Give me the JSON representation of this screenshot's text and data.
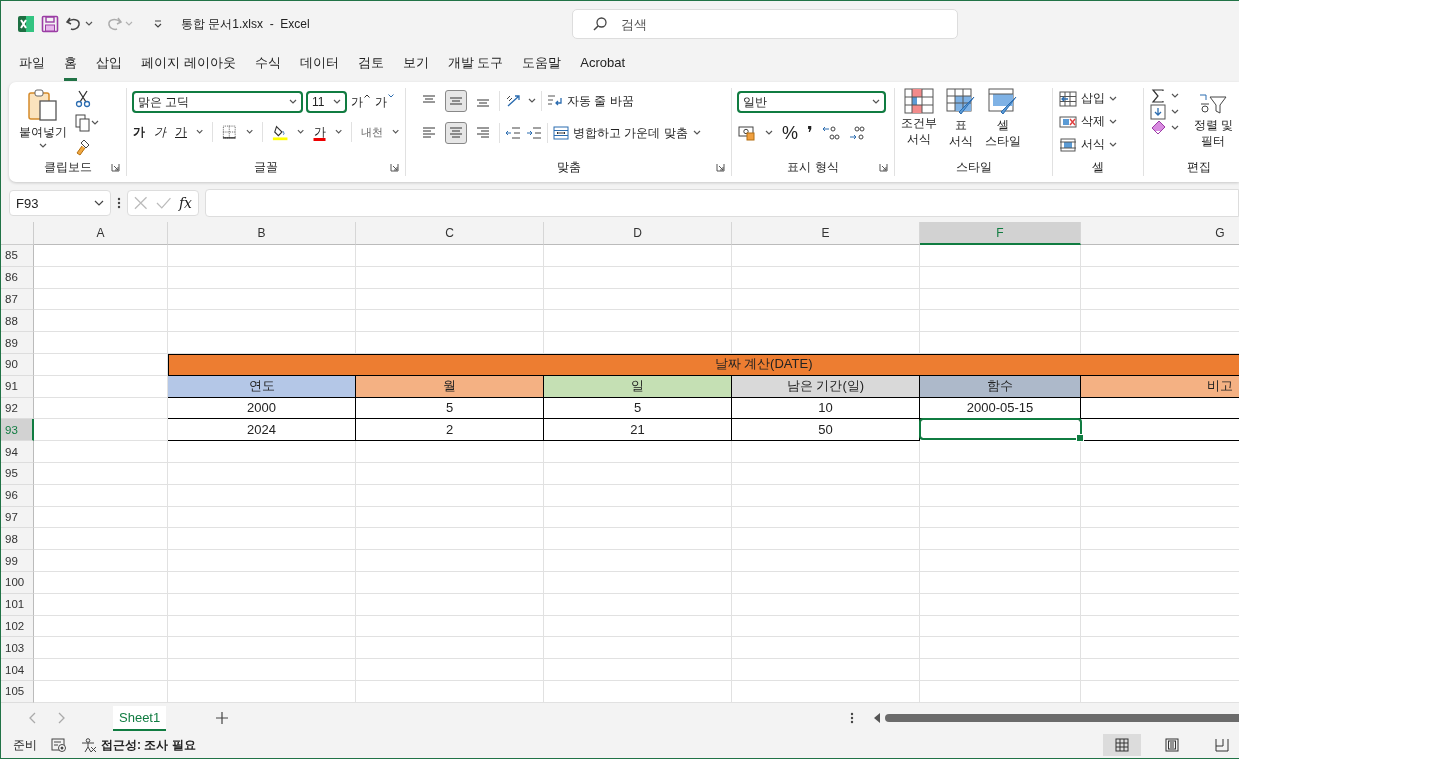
{
  "title_bar": {
    "title": "통합 문서1.xlsx  -  Excel",
    "search": {
      "placeholder": "검색"
    },
    "redo_disabled": true
  },
  "menu_tabs": [
    {
      "label": "파일",
      "selected": false
    },
    {
      "label": "홈",
      "selected": true
    },
    {
      "label": "삽입",
      "selected": false
    },
    {
      "label": "페이지 레이아웃",
      "selected": false
    },
    {
      "label": "수식",
      "selected": false
    },
    {
      "label": "데이터",
      "selected": false
    },
    {
      "label": "검토",
      "selected": false
    },
    {
      "label": "보기",
      "selected": false
    },
    {
      "label": "개발 도구",
      "selected": false
    },
    {
      "label": "도움말",
      "selected": false
    },
    {
      "label": "Acrobat",
      "selected": false
    }
  ],
  "ribbon": {
    "clipboard": {
      "label": "클립보드",
      "paste": "붙여넣기"
    },
    "font": {
      "label": "글꼴",
      "font_name": "맑은 고딕",
      "font_size": "11",
      "grow": "가",
      "shrink": "가",
      "bold": "가",
      "italic": "가",
      "underline": "가",
      "font_color": "가",
      "phonetic": "내천"
    },
    "alignment": {
      "label": "맞춤",
      "vertical": [
        {
          "selected": false
        },
        {
          "selected": true
        },
        {
          "selected": false
        }
      ],
      "horizontal": [
        {
          "selected": false
        },
        {
          "selected": true
        },
        {
          "selected": false
        }
      ],
      "wrap_text": "자동 줄 바꿈",
      "merge_center": "병합하고 가운데 맞춤"
    },
    "number": {
      "label": "표시 형식",
      "format": "일반",
      "percent": "%",
      "comma": "❜"
    },
    "styles": {
      "label": "스타일",
      "items": [
        {
          "kind": "conditional",
          "label": "조건부 서식"
        },
        {
          "kind": "table",
          "label": "표 서식"
        },
        {
          "kind": "cell",
          "label": "셀 스타일"
        }
      ]
    },
    "cells": {
      "label": "셀",
      "items": [
        {
          "kind": "insert",
          "label": "삽입"
        },
        {
          "kind": "delete",
          "label": "삭제"
        },
        {
          "kind": "format",
          "label": "서식"
        }
      ]
    },
    "editing": {
      "label": "편집",
      "sort_filter": "정렬 및 필터"
    }
  },
  "formula_bar": {
    "name_box": "F93",
    "function_button": "fx"
  },
  "sheet": {
    "columns": [
      {
        "label": "A",
        "selected": false
      },
      {
        "label": "B",
        "selected": false
      },
      {
        "label": "C",
        "selected": false
      },
      {
        "label": "D",
        "selected": false
      },
      {
        "label": "E",
        "selected": false
      },
      {
        "label": "F",
        "selected": true
      },
      {
        "label": "G",
        "selected": false
      }
    ],
    "rows": [
      {
        "label": "85",
        "selected": false,
        "kind": "empty"
      },
      {
        "label": "86",
        "selected": false,
        "kind": "empty"
      },
      {
        "label": "87",
        "selected": false,
        "kind": "empty"
      },
      {
        "label": "88",
        "selected": false,
        "kind": "empty"
      },
      {
        "label": "89",
        "selected": false,
        "kind": "empty"
      },
      {
        "label": "90",
        "selected": false,
        "kind": "title",
        "title": "날짜 계산(DATE)"
      },
      {
        "label": "91",
        "selected": false,
        "kind": "header",
        "headers": [
          {
            "label": "연도",
            "color": "#b4c7e7"
          },
          {
            "label": "월",
            "color": "#f4b183"
          },
          {
            "label": "일",
            "color": "#c5e0b4"
          },
          {
            "label": "남은 기간(일)",
            "color": "#d9d9d9"
          },
          {
            "label": "함수",
            "color": "#adb9ca"
          },
          {
            "label": "비고",
            "color": "#f4b183"
          }
        ]
      },
      {
        "label": "92",
        "selected": false,
        "kind": "data",
        "cells": [
          "2000",
          "5",
          "5",
          "10",
          "2000-05-15"
        ]
      },
      {
        "label": "93",
        "selected": true,
        "kind": "data",
        "cells": [
          "2024",
          "2",
          "21",
          "50"
        ]
      },
      {
        "label": "94",
        "selected": false,
        "kind": "empty"
      },
      {
        "label": "95",
        "selected": false,
        "kind": "empty"
      },
      {
        "label": "96",
        "selected": false,
        "kind": "empty"
      },
      {
        "label": "97",
        "selected": false,
        "kind": "empty"
      },
      {
        "label": "98",
        "selected": false,
        "kind": "empty"
      },
      {
        "label": "99",
        "selected": false,
        "kind": "empty"
      },
      {
        "label": "100",
        "selected": false,
        "kind": "empty"
      },
      {
        "label": "101",
        "selected": false,
        "kind": "empty"
      },
      {
        "label": "102",
        "selected": false,
        "kind": "empty"
      },
      {
        "label": "103",
        "selected": false,
        "kind": "empty"
      },
      {
        "label": "104",
        "selected": false,
        "kind": "empty"
      },
      {
        "label": "105",
        "selected": false,
        "kind": "empty"
      }
    ]
  },
  "sheet_tabs": [
    {
      "label": "Sheet1",
      "selected": true
    }
  ],
  "status_bar": {
    "ready": "준비",
    "accessibility": "접근성: 조사 필요",
    "views": [
      {
        "kind": "normal",
        "selected": true
      },
      {
        "kind": "page_layout",
        "selected": false
      },
      {
        "kind": "page_break",
        "selected": false
      }
    ]
  }
}
